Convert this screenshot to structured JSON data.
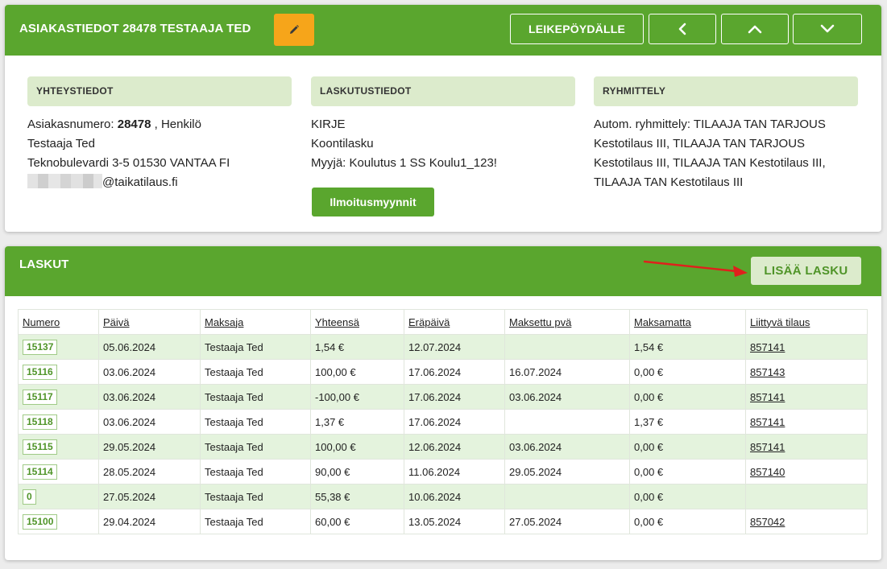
{
  "customer_header": {
    "title": "ASIAKASTIEDOT 28478 TESTAAJA TED",
    "clipboard_label": "LEIKEPÖYDÄLLE"
  },
  "contact": {
    "heading": "YHTEYSTIEDOT",
    "customer_number_label": "Asiakasnumero:",
    "customer_number": "28478",
    "customer_type": ", Henkilö",
    "name": "Testaaja Ted",
    "address": "Teknobulevardi 3-5 01530 VANTAA FI",
    "email_domain": "@taikatilaus.fi"
  },
  "billing": {
    "heading": "LASKUTUSTIEDOT",
    "method": "KIRJE",
    "type": "Koontilasku",
    "seller": "Myyjä: Koulutus 1 SS Koulu1_123!",
    "ads_button": "Ilmoitusmyynnit"
  },
  "grouping": {
    "heading": "RYHMITTELY",
    "text": "Autom. ryhmittely: TILAAJA TAN TARJOUS Kestotilaus III, TILAAJA TAN TARJOUS Kestotilaus III, TILAAJA TAN Kestotilaus III, TILAAJA TAN Kestotilaus III"
  },
  "invoices": {
    "title": "LASKUT",
    "add_button": "LISÄÄ LASKU",
    "columns": [
      "Numero",
      "Päivä",
      "Maksaja",
      "Yhteensä",
      "Eräpäivä",
      "Maksettu pvä",
      "Maksamatta",
      "Liittyvä tilaus"
    ],
    "rows": [
      {
        "number": "15137",
        "date": "05.06.2024",
        "payer": "Testaaja Ted",
        "total": "1,54 €",
        "due": "12.07.2024",
        "paid": "",
        "unpaid": "1,54 €",
        "order": "857141"
      },
      {
        "number": "15116",
        "date": "03.06.2024",
        "payer": "Testaaja Ted",
        "total": "100,00 €",
        "due": "17.06.2024",
        "paid": "16.07.2024",
        "unpaid": "0,00 €",
        "order": "857143"
      },
      {
        "number": "15117",
        "date": "03.06.2024",
        "payer": "Testaaja Ted",
        "total": "-100,00 €",
        "due": "17.06.2024",
        "paid": "03.06.2024",
        "unpaid": "0,00 €",
        "order": "857141"
      },
      {
        "number": "15118",
        "date": "03.06.2024",
        "payer": "Testaaja Ted",
        "total": "1,37 €",
        "due": "17.06.2024",
        "paid": "",
        "unpaid": "1,37 €",
        "order": "857141"
      },
      {
        "number": "15115",
        "date": "29.05.2024",
        "payer": "Testaaja Ted",
        "total": "100,00 €",
        "due": "12.06.2024",
        "paid": "03.06.2024",
        "unpaid": "0,00 €",
        "order": "857141"
      },
      {
        "number": "15114",
        "date": "28.05.2024",
        "payer": "Testaaja Ted",
        "total": "90,00 €",
        "due": "11.06.2024",
        "paid": "29.05.2024",
        "unpaid": "0,00 €",
        "order": "857140"
      },
      {
        "number": "0",
        "date": "27.05.2024",
        "payer": "Testaaja Ted",
        "total": "55,38 €",
        "due": "10.06.2024",
        "paid": "",
        "unpaid": "0,00 €",
        "order": ""
      },
      {
        "number": "15100",
        "date": "29.04.2024",
        "payer": "Testaaja Ted",
        "total": "60,00 €",
        "due": "13.05.2024",
        "paid": "27.05.2024",
        "unpaid": "0,00 €",
        "order": "857042"
      }
    ]
  },
  "icons": {
    "edit": "pencil-icon",
    "prev": "chevron-left-icon",
    "up": "chevron-up-icon",
    "down": "chevron-down-icon",
    "annotation": "red-arrow-icon"
  },
  "colors": {
    "brand_green": "#5aa62e",
    "light_green": "#dcebcc",
    "edit_orange": "#f6a51a",
    "row_stripe": "#e4f3dd",
    "annotation_red": "#e0201c"
  }
}
